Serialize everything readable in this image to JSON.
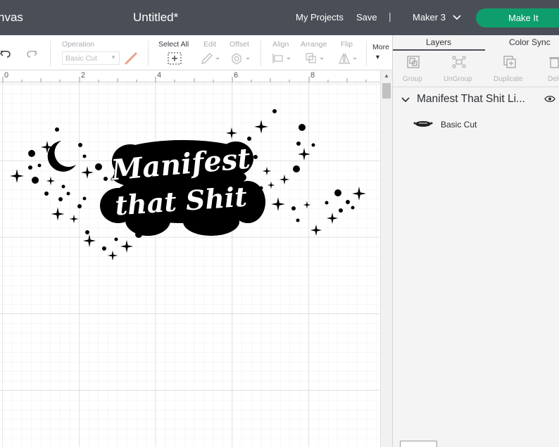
{
  "header": {
    "canvas_label": "nvas",
    "document_title": "Untitled*",
    "my_projects": "My Projects",
    "save": "Save",
    "divider": "|",
    "machine": "Maker 3",
    "make_it": "Make It"
  },
  "toolbar": {
    "operation_label": "Operation",
    "operation_value": "Basic Cut",
    "select_all": "Select All",
    "edit": "Edit",
    "offset": "Offset",
    "align": "Align",
    "arrange": "Arrange",
    "flip": "Flip",
    "more": "More"
  },
  "ruler": {
    "marks": [
      "0",
      "2",
      "4",
      "6",
      "8"
    ]
  },
  "design": {
    "line1": "Manifest",
    "line2": "that Shit"
  },
  "panel": {
    "tabs": [
      "Layers",
      "Color Sync"
    ],
    "active_tab": "Layers",
    "tools": [
      "Group",
      "UnGroup",
      "Duplicate",
      "Dele"
    ],
    "group_name": "Manifest That Shit Li...",
    "layer_name": "Basic Cut"
  },
  "colors": {
    "header_bg": "#4a4f57",
    "accent_green": "#0e9e6e",
    "design_black": "#000000"
  }
}
